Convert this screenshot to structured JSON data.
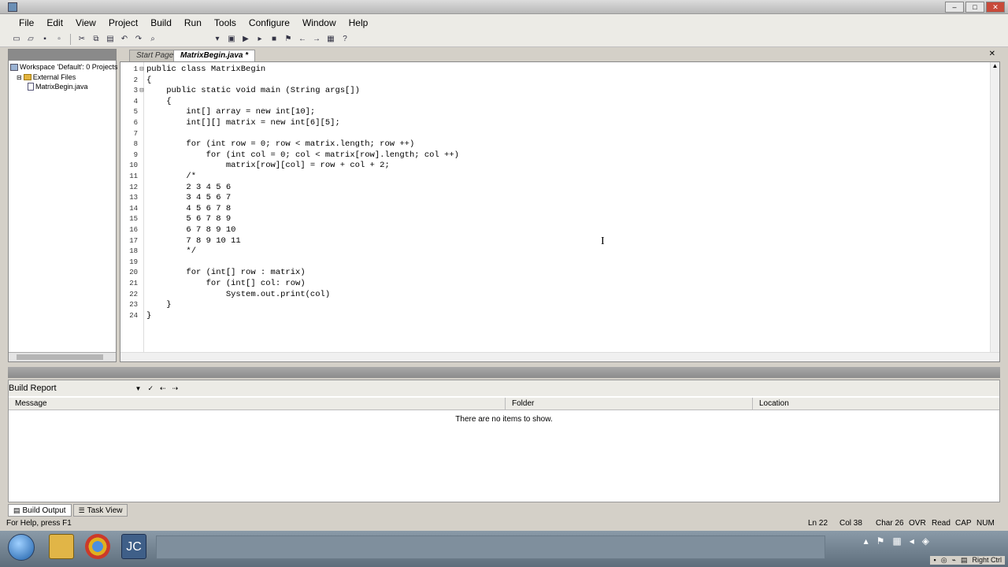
{
  "menu": [
    "File",
    "Edit",
    "View",
    "Project",
    "Build",
    "Run",
    "Tools",
    "Configure",
    "Window",
    "Help"
  ],
  "workspace": {
    "items": [
      {
        "label": "Workspace 'Default': 0 Projects"
      },
      {
        "label": "External Files"
      },
      {
        "label": "MatrixBegin.java"
      }
    ]
  },
  "tabs": {
    "start": "Start Page",
    "active": "MatrixBegin.java *",
    "close": "✕"
  },
  "code_lines": [
    {
      "n": "1",
      "fold": "⊟",
      "text": "public class MatrixBegin"
    },
    {
      "n": "2",
      "fold": "",
      "text": "{"
    },
    {
      "n": "3",
      "fold": "⊟",
      "text": "    public static void main (String args[])"
    },
    {
      "n": "4",
      "fold": "",
      "text": "    {"
    },
    {
      "n": "5",
      "fold": "",
      "text": "        int[] array = new int[10];"
    },
    {
      "n": "6",
      "fold": "",
      "text": "        int[][] matrix = new int[6][5];"
    },
    {
      "n": "7",
      "fold": "",
      "text": ""
    },
    {
      "n": "8",
      "fold": "",
      "text": "        for (int row = 0; row < matrix.length; row ++)"
    },
    {
      "n": "9",
      "fold": "",
      "text": "            for (int col = 0; col < matrix[row].length; col ++)"
    },
    {
      "n": "10",
      "fold": "",
      "text": "                matrix[row][col] = row + col + 2;"
    },
    {
      "n": "11",
      "fold": "",
      "text": "        /*"
    },
    {
      "n": "12",
      "fold": "",
      "text": "        2 3 4 5 6"
    },
    {
      "n": "13",
      "fold": "",
      "text": "        3 4 5 6 7"
    },
    {
      "n": "14",
      "fold": "",
      "text": "        4 5 6 7 8"
    },
    {
      "n": "15",
      "fold": "",
      "text": "        5 6 7 8 9"
    },
    {
      "n": "16",
      "fold": "",
      "text": "        6 7 8 9 10"
    },
    {
      "n": "17",
      "fold": "",
      "text": "        7 8 9 10 11"
    },
    {
      "n": "18",
      "fold": "",
      "text": "        */"
    },
    {
      "n": "19",
      "fold": "",
      "text": ""
    },
    {
      "n": "20",
      "fold": "",
      "text": "        for (int[] row : matrix)"
    },
    {
      "n": "21",
      "fold": "",
      "text": "            for (int[] col: row)"
    },
    {
      "n": "22",
      "fold": "",
      "text": "                System.out.print(col)"
    },
    {
      "n": "23",
      "fold": "",
      "text": "    }"
    },
    {
      "n": "24",
      "fold": "",
      "text": "}"
    }
  ],
  "build": {
    "title": "Build Report",
    "columns": [
      "Message",
      "Folder",
      "Location"
    ],
    "empty": "There are no items to show."
  },
  "bottom_tabs": [
    "Build Output",
    "Task View"
  ],
  "status": {
    "help": "For Help, press F1",
    "ln": "Ln 22",
    "col": "Col 38",
    "char": "Char 26",
    "ovr": "OVR",
    "read": "Read",
    "cap": "CAP",
    "num": "NUM"
  },
  "taskbar": {
    "jc_label": "JC",
    "tray_right": "Right Ctrl"
  }
}
